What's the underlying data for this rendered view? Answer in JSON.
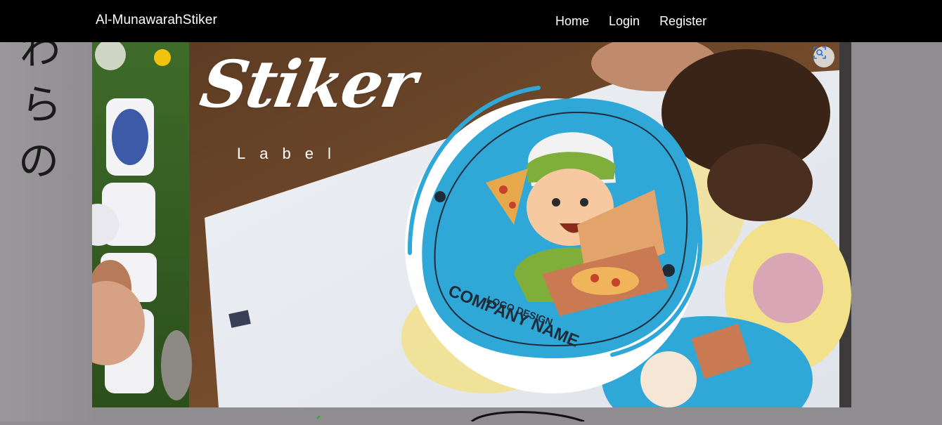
{
  "navbar": {
    "brand": "Al-MunawarahStiker",
    "links": [
      "Home",
      "Login",
      "Register"
    ]
  },
  "hero": {
    "logo_word": "Stiker",
    "logo_sub": "Label",
    "sticker_line1": "LOGO DESIGN",
    "sticker_line2": "COMPANY NAME",
    "zoom_icon": "scan-zoom-icon"
  },
  "background": {
    "glyphs": [
      "わ",
      "ら",
      "の"
    ]
  },
  "colors": {
    "navbar": "#000000",
    "page_bg": "#8f8d8f",
    "sticker_blue": "#2fa8d8",
    "sticker_yellow": "#f3e08a",
    "text_on_dark": "#ffffff"
  }
}
